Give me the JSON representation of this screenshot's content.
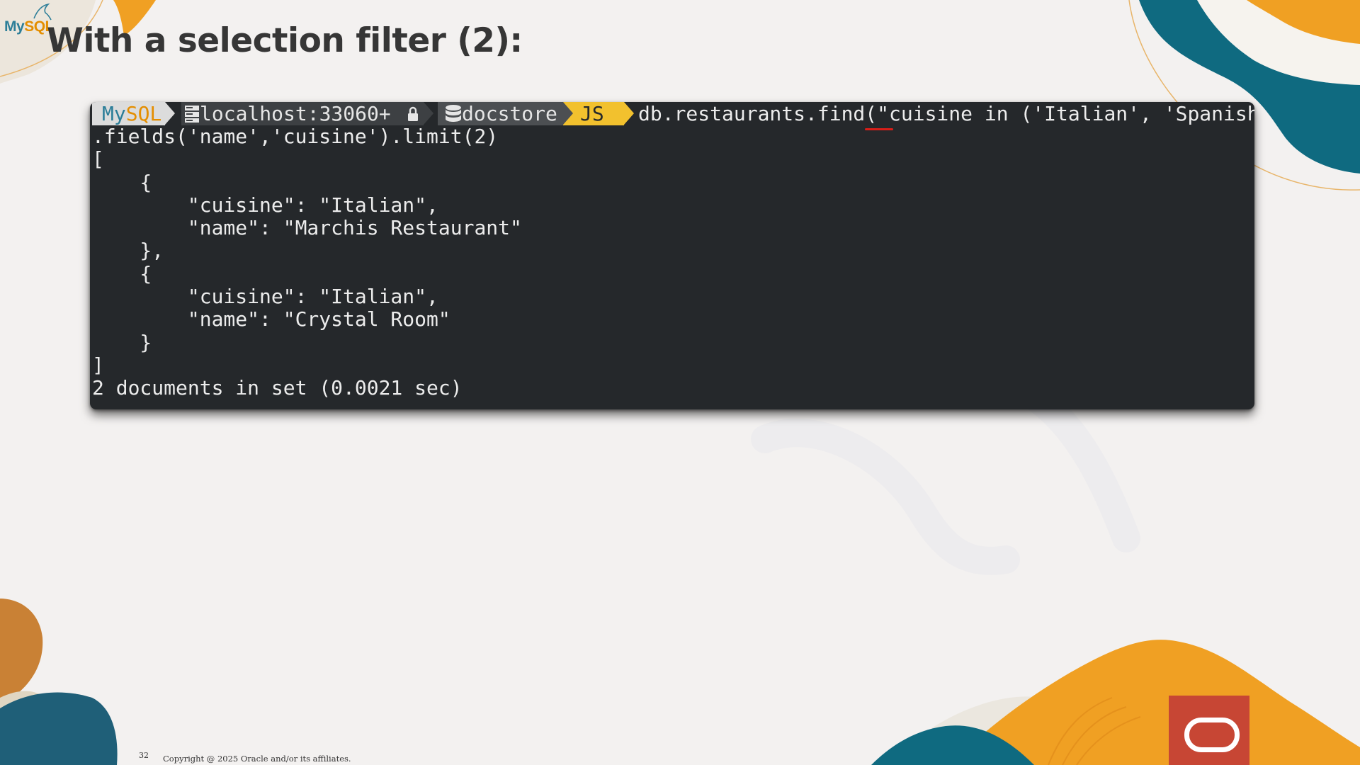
{
  "logo": {
    "brand": "MySQL",
    "part_my": "My",
    "part_sql": "SQL"
  },
  "slide": {
    "title": "With a selection filter (2):",
    "page_number": "32",
    "copyright": "Copyright @ 2025 Oracle and/or its affiliates."
  },
  "terminal": {
    "prompt": {
      "mode_label": "MySQL",
      "host": "localhost:33060+",
      "schema": "docstore",
      "language": "JS",
      "host_icon": "server-icon",
      "lock_icon": "lock-icon",
      "schema_icon": "database-icon"
    },
    "command": "db.restaurants.find(\"cuisine in ('Italian', 'Spanish')\")",
    "output_lines": [
      ".fields('name','cuisine').limit(2)",
      "[",
      "    {",
      "        \"cuisine\": \"Italian\",",
      "        \"name\": \"Marchis Restaurant\"",
      "    },",
      "    {",
      "        \"cuisine\": \"Italian\",",
      "        \"name\": \"Crystal Room\"",
      "    }",
      "]",
      "2 documents in set (0.0021 sec)"
    ]
  },
  "colors": {
    "terminal_bg": "#25282b",
    "prompt_js": "#f2c12e",
    "mysql_blue": "#2b7d98",
    "mysql_orange": "#e48e00",
    "teal": "#0f6a80",
    "orange": "#f0a023",
    "oracle_red": "#c74634",
    "underline_red": "#d91e18"
  }
}
